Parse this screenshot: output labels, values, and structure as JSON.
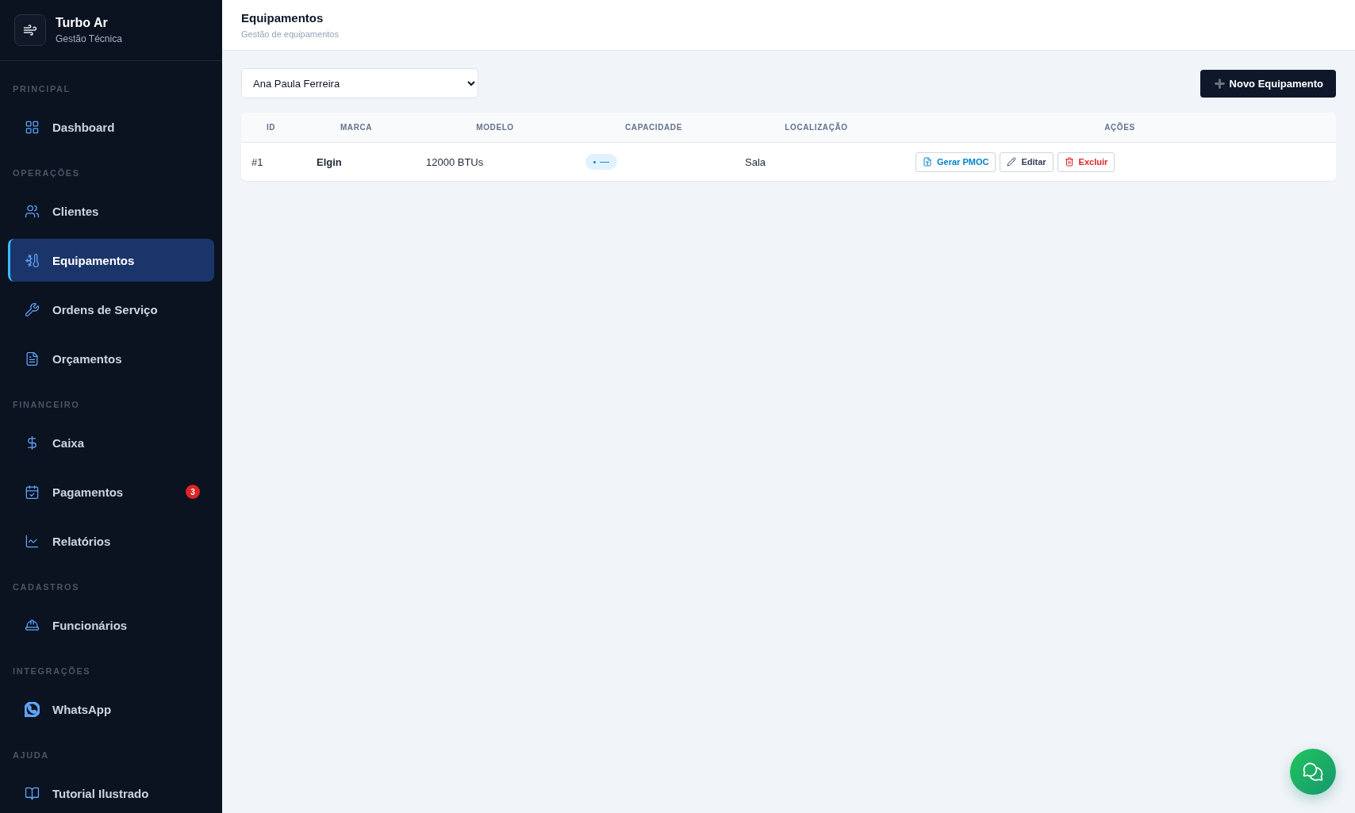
{
  "brand": {
    "name": "Turbo Ar",
    "subtitle": "Gestão Técnica"
  },
  "nav_sections": [
    {
      "label": "PRINCIPAL",
      "items": [
        {
          "label": "Dashboard",
          "selected": false
        }
      ]
    },
    {
      "label": "OPERAÇÕES",
      "items": [
        {
          "label": "Clientes",
          "selected": false
        },
        {
          "label": "Equipamentos",
          "selected": true
        },
        {
          "label": "Ordens de Serviço",
          "selected": false
        },
        {
          "label": "Orçamentos",
          "selected": false
        }
      ]
    },
    {
      "label": "FINANCEIRO",
      "items": [
        {
          "label": "Caixa",
          "selected": false
        },
        {
          "label": "Pagamentos",
          "selected": false,
          "badge": "3"
        },
        {
          "label": "Relatórios",
          "selected": false
        }
      ]
    },
    {
      "label": "CADASTROS",
      "items": [
        {
          "label": "Funcionários",
          "selected": false
        }
      ]
    },
    {
      "label": "INTEGRAÇÕES",
      "items": [
        {
          "label": "WhatsApp",
          "selected": false
        }
      ]
    },
    {
      "label": "AJUDA",
      "items": [
        {
          "label": "Tutorial Ilustrado",
          "selected": false
        }
      ]
    }
  ],
  "header": {
    "title": "Equipamentos",
    "subtitle": "Gestão de equipamentos"
  },
  "client_select": {
    "value": "Ana Paula Ferreira"
  },
  "new_button": {
    "label": "Novo Equipamento"
  },
  "table": {
    "columns": [
      "ID",
      "MARCA",
      "MODELO",
      "CAPACIDADE",
      "LOCALIZAÇÃO",
      "AÇÕES"
    ],
    "rows": [
      {
        "id": "#1",
        "marca": "Elgin",
        "modelo": "12000 BTUs",
        "capacidade": "—",
        "localizacao": "Sala",
        "actions": [
          {
            "label": "Gerar PMOC",
            "kind": "pdf"
          },
          {
            "label": "Editar",
            "kind": "edit"
          },
          {
            "label": "Excluir",
            "kind": "delete"
          }
        ]
      }
    ]
  }
}
